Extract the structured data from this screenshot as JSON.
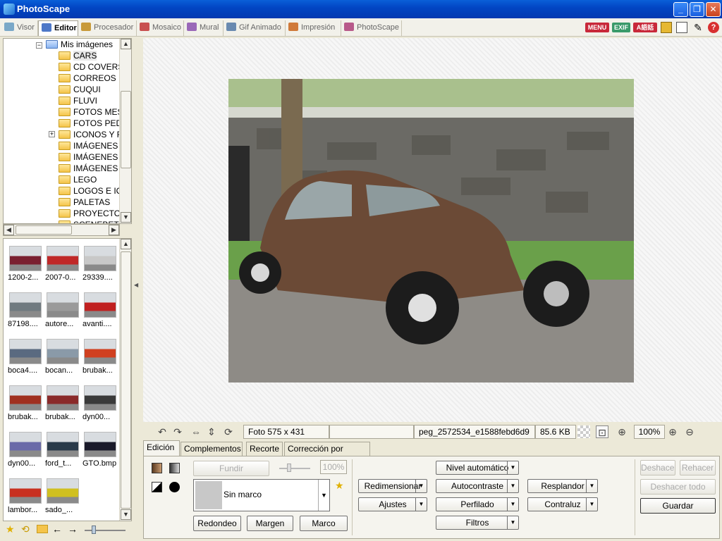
{
  "window": {
    "title": "PhotoScape"
  },
  "tabs": [
    {
      "label": "Visor"
    },
    {
      "label": "Editor"
    },
    {
      "label": "Procesador"
    },
    {
      "label": "Mosaico"
    },
    {
      "label": "Mural"
    },
    {
      "label": "Gif Animado"
    },
    {
      "label": "Impresión"
    },
    {
      "label": "PhotoScape"
    }
  ],
  "top_right": {
    "menu": "MENU",
    "exif": "EXIF",
    "lang": "A語話"
  },
  "tree": {
    "root": "Mis imágenes",
    "items": [
      "CARS",
      "CD COVERS",
      "CORREOS",
      "CUQUI",
      "FLUVI",
      "FOTOS MES",
      "FOTOS PED",
      "ICONOS Y F",
      "IMÁGENES (",
      "IMÁGENES I",
      "IMÁGENES ",
      "LEGO",
      "LOGOS E IC",
      "PALETAS",
      "PROYECTOS",
      "SCENEBETA"
    ]
  },
  "thumbnails": [
    {
      "caption": "1200-2..."
    },
    {
      "caption": "2007-0..."
    },
    {
      "caption": "29339...."
    },
    {
      "caption": "87198...."
    },
    {
      "caption": "autore..."
    },
    {
      "caption": "avanti...."
    },
    {
      "caption": "boca4...."
    },
    {
      "caption": "bocan..."
    },
    {
      "caption": "brubak..."
    },
    {
      "caption": "brubak..."
    },
    {
      "caption": "brubak..."
    },
    {
      "caption": "dyn00..."
    },
    {
      "caption": "dyn00..."
    },
    {
      "caption": "ford_t..."
    },
    {
      "caption": "GTO.bmp"
    },
    {
      "caption": "lambor..."
    },
    {
      "caption": "sado_..."
    }
  ],
  "status": {
    "photo_size": "Foto 575 x 431",
    "filename": "peg_2572534_e1588febd6d9",
    "filesize": "85.6 KB",
    "zoom": "100%"
  },
  "edit_tabs": [
    "Edición",
    "Complementos",
    "Recorte",
    "Corrección por zonas"
  ],
  "edit": {
    "fundir": "Fundir",
    "fundir_pct": "100%",
    "frame": "Sin marco",
    "redondeo": "Redondeo",
    "margen": "Margen",
    "marco": "Marco",
    "nivel": "Nivel automático",
    "redimensionar": "Redimensionar",
    "autocontraste": "Autocontraste",
    "resplandor": "Resplandor",
    "ajustes": "Ajustes",
    "perfilado": "Perfilado",
    "contraluz": "Contraluz",
    "filtros": "Filtros",
    "deshacer": "Deshacer",
    "rehacer": "Rehacer",
    "deshacer_todo": "Deshacer todo",
    "guardar": "Guardar"
  }
}
